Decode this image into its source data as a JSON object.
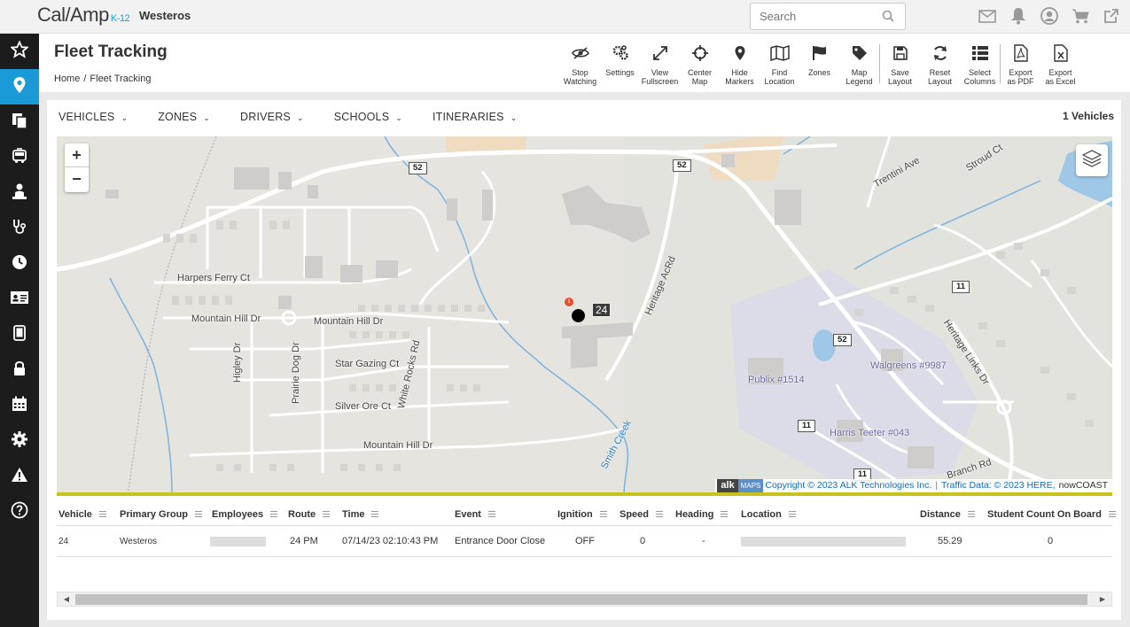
{
  "top": {
    "logo_text": "Cal/Amp",
    "logo_suffix": "K-12",
    "org_name": "Westeros",
    "search_placeholder": "Search"
  },
  "header": {
    "title": "Fleet Tracking",
    "breadcrumb": [
      "Home",
      "Fleet Tracking"
    ]
  },
  "toolbar": [
    {
      "label1": "Stop",
      "label2": "Watching",
      "icon": "eye-slash-icon"
    },
    {
      "label1": "Settings",
      "label2": "",
      "icon": "gears-icon"
    },
    {
      "label1": "View",
      "label2": "Fullscreen",
      "icon": "expand-icon"
    },
    {
      "label1": "Center",
      "label2": "Map",
      "icon": "crosshairs-icon"
    },
    {
      "label1": "Hide",
      "label2": "Markers",
      "icon": "map-marker-icon"
    },
    {
      "label1": "Find",
      "label2": "Location",
      "icon": "map-icon"
    },
    {
      "label1": "Zones",
      "label2": "",
      "icon": "flag-icon"
    },
    {
      "label1": "Map",
      "label2": "Legend",
      "icon": "tag-icon"
    },
    {
      "label1": "Save",
      "label2": "Layout",
      "icon": "save-icon"
    },
    {
      "label1": "Reset",
      "label2": "Layout",
      "icon": "refresh-icon"
    },
    {
      "label1": "Select",
      "label2": "Columns",
      "icon": "list-icon"
    },
    {
      "label1": "Export",
      "label2": "as PDF",
      "icon": "pdf-file-icon"
    },
    {
      "label1": "Export",
      "label2": "as Excel",
      "icon": "excel-file-icon"
    }
  ],
  "filters": [
    "VEHICLES",
    "ZONES",
    "DRIVERS",
    "SCHOOLS",
    "ITINERARIES"
  ],
  "vehicle_count": "1 Vehicles",
  "map": {
    "zoom_in": "+",
    "zoom_out": "−",
    "vehicle_label": "24",
    "alert_count": "1",
    "attribution_alk": "alk",
    "attribution_maps": "MAPS",
    "attribution_copyright": "Copyright © 2023 ALK Technologies Inc.",
    "attribution_sep": "|",
    "attribution_traffic": "Traffic Data: © 2023 HERE,",
    "attribution_nowcoast": "nowCOAST",
    "streets": {
      "harpers": "Harpers Ferry Ct",
      "mountain1": "Mountain Hill Dr",
      "mountain2": "Mountain Hill Dr",
      "mountain3": "Mountain Hill Dr",
      "stargazing": "Star Gazing Ct",
      "silverore": "Silver Ore Ct",
      "higley": "Higley Dr",
      "prairie": "Prairie Dog Dr",
      "whiterocks": "White Rocks Rd",
      "heritageac": "Heritage AcRd",
      "heritagelinks": "Heritage Links Dr",
      "trentini": "Trentini Ave",
      "stroud": "Stroud Ct",
      "smithcreek": "Smith Creek",
      "branch": "Branch Rd",
      "publix": "Publix #1514",
      "walgreens": "Walgreens #9987",
      "harristeeter": "Harris Teeter #043"
    },
    "shields": {
      "r52a": "52",
      "r52b": "52",
      "r52c": "52",
      "r11a": "11",
      "r11b": "11",
      "r11c": "11"
    }
  },
  "table": {
    "columns": [
      "Vehicle",
      "Primary Group",
      "Employees",
      "Route",
      "Time",
      "Event",
      "Ignition",
      "Speed",
      "Heading",
      "Location",
      "Distance",
      "Student Count On Board"
    ],
    "row": {
      "vehicle": "24",
      "primary_group": "Westeros",
      "route": "24 PM",
      "time": "07/14/23 02:10:43 PM",
      "event": "Entrance Door Close",
      "ignition": "OFF",
      "speed": "0",
      "heading": "-",
      "distance": "55.29",
      "student_count": "0"
    }
  },
  "colors": {
    "accent": "#1a9ad6",
    "nav_bg": "#1c1c1c",
    "map_border": "#c8c21e",
    "alert": "#e8502a"
  }
}
